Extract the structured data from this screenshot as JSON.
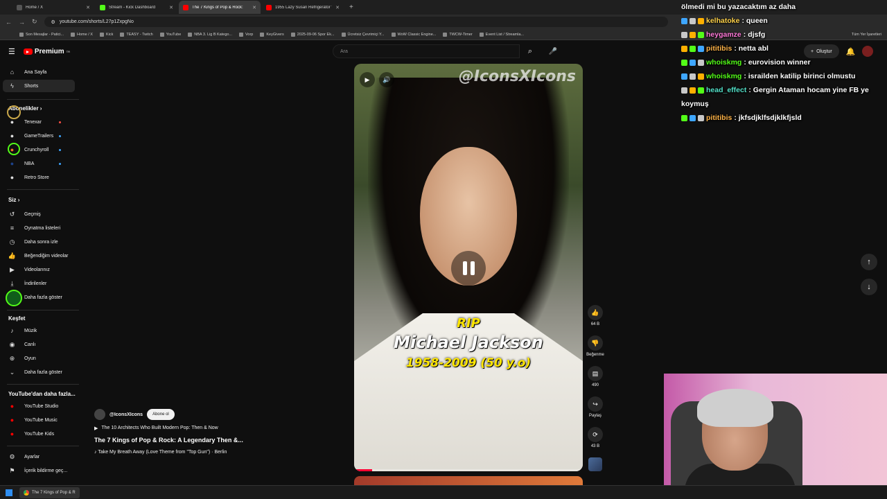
{
  "browser": {
    "tabs": [
      {
        "label": "Home / X",
        "color": "#1d1d1d",
        "active": false
      },
      {
        "label": "Stream - Kick Dashboard",
        "color": "#53fc18",
        "active": false
      },
      {
        "label": "The 7 Kings of Pop & Rock:",
        "color": "#ff0000",
        "active": true
      },
      {
        "label": "1955 Lazy Susan Refrigerator V",
        "color": "#ff0000",
        "active": false
      }
    ],
    "new_tab": "+",
    "url": "youtube.com/shorts/L27p1ZxpgNo",
    "bookmarks": [
      "Son Mesajlar - Patici...",
      "Home / X",
      "Kick",
      "TEASY - Twitch",
      "YouTube",
      "NBA 3. Lig B Katego...",
      "Vorp",
      "KeyGivers",
      "2025-09-06 Spor Ek...",
      "Ücretsiz Çevrimiçi Y...",
      "WoW Classic Engine...",
      "TWCW-Timer",
      "Event List / Streamla..."
    ],
    "all_bookmarks": "Tüm Yer İşaretleri"
  },
  "youtube": {
    "logo_text": "Premium",
    "logo_sup": "TR",
    "search_placeholder": "Ara",
    "create_label": "Oluştur",
    "sidebar": {
      "main": [
        {
          "label": "Ana Sayfa",
          "icon": "home-icon"
        },
        {
          "label": "Shorts",
          "icon": "shorts-icon"
        }
      ],
      "subs_header": "Abonelikler",
      "subs": [
        {
          "label": "Tenexar",
          "live": true
        },
        {
          "label": "GameTrailers",
          "live": false
        },
        {
          "label": "Crunchyroll",
          "live": false
        },
        {
          "label": "NBA",
          "live": false
        },
        {
          "label": "Retro Store",
          "live": false
        }
      ],
      "you_header": "Siz",
      "you": [
        {
          "label": "Geçmiş",
          "icon": "history-icon"
        },
        {
          "label": "Oynatma listeleri",
          "icon": "playlist-icon"
        },
        {
          "label": "Daha sonra izle",
          "icon": "clock-icon"
        },
        {
          "label": "Beğendiğim videolar",
          "icon": "like-icon"
        },
        {
          "label": "Videolarınız",
          "icon": "video-icon"
        },
        {
          "label": "İndirilenler",
          "icon": "download-icon"
        },
        {
          "label": "Daha fazla göster",
          "icon": "chevron-down-icon"
        }
      ],
      "explore_header": "Keşfet",
      "explore": [
        {
          "label": "Müzik",
          "icon": "music-icon"
        },
        {
          "label": "Canlı",
          "icon": "live-icon"
        },
        {
          "label": "Oyun",
          "icon": "gaming-icon"
        },
        {
          "label": "Daha fazla göster",
          "icon": "chevron-down-icon"
        }
      ],
      "more_header": "YouTube'dan daha fazla...",
      "more": [
        {
          "label": "YouTube Studio"
        },
        {
          "label": "YouTube Music"
        },
        {
          "label": "YouTube Kids"
        }
      ],
      "bottom": [
        {
          "label": "Ayarlar",
          "icon": "gear-icon"
        },
        {
          "label": "İçerik bildirme geç...",
          "icon": "flag-icon"
        }
      ]
    },
    "short": {
      "watermark": "@IconsXIcons",
      "caption_line1": "RIP",
      "caption_line2": "Michael Jackson",
      "caption_line3": "1958-2009 (50 y.o)",
      "progress": 0.08
    },
    "actions": {
      "like_count": "64 B",
      "dislike_label": "Beğenme",
      "comment_count": "490",
      "share_label": "Paylaş",
      "remix_count": "43 B"
    },
    "meta": {
      "channel": "@IconsXIcons",
      "subscribe": "Abone ol",
      "related": "The 10 Architects Who Built Modern Pop: Then & Now",
      "title": "The 7 Kings of Pop & Rock: A Legendary Then &...",
      "music": "Take My Breath Away (Love Theme from \"Top Gun\") · Berlin"
    }
  },
  "chat": [
    {
      "user": "",
      "text": "ölmedi mi bu yazacaktım az daha",
      "color": "#ffffff"
    },
    {
      "user": "kelhatoke",
      "text": ": queen",
      "color": "#ffd24a"
    },
    {
      "user": "heygamze",
      "text": ": djsfg",
      "color": "#ff7ad9"
    },
    {
      "user": "pititibis",
      "text": ": netta abl",
      "color": "#ffb347"
    },
    {
      "user": "whoiskmg",
      "text": ": eurovision winner",
      "color": "#53fc18"
    },
    {
      "user": "whoiskmg",
      "text": ": israilden katilip birinci olmustu",
      "color": "#53fc18"
    },
    {
      "user": "head_effect",
      "text": ": Gergin Ataman hocam yine FB ye",
      "color": "#53e0c8"
    },
    {
      "user": "",
      "text": "koymuş",
      "color": "#ffffff"
    },
    {
      "user": "pititibis",
      "text": ": jkfsdjklfsdjklkfjsld",
      "color": "#ffb347"
    }
  ],
  "taskbar": {
    "task": "The 7 Kings of Pop & R"
  }
}
